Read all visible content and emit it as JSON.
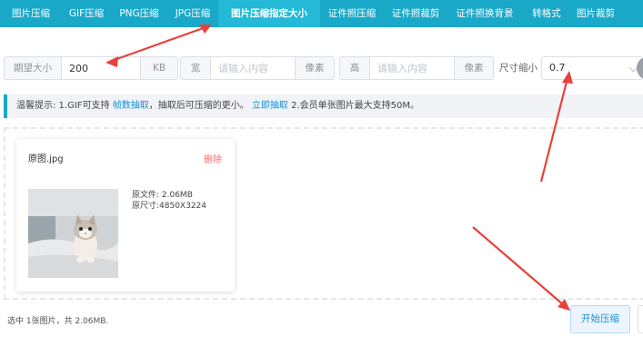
{
  "nav": {
    "tabs": [
      {
        "label": "图片压缩"
      },
      {
        "label": "GIF压缩"
      },
      {
        "label": "PNG压缩"
      },
      {
        "label": "JPG压缩"
      },
      {
        "label": "图片压缩指定大小",
        "active": true
      },
      {
        "label": "证件照压缩"
      },
      {
        "label": "证件照裁剪"
      },
      {
        "label": "证件照换背景"
      },
      {
        "label": "转格式"
      },
      {
        "label": "图片裁剪"
      }
    ]
  },
  "form": {
    "size_label": "期望大小",
    "size_value": "200",
    "size_unit": "KB",
    "width_label": "宽",
    "width_placeholder": "请输入内容",
    "width_unit": "像素",
    "height_label": "高",
    "height_placeholder": "请输入内容",
    "height_unit": "像素",
    "scale_label": "尺寸缩小",
    "scale_value": "0.7"
  },
  "tip": {
    "prefix": "温馨提示: 1.GIF可支持 ",
    "link1": "帧数抽取",
    "middle": "，抽取后可压缩的更小。",
    "link2": "立即抽取",
    "suffix": " 2.会员单张图片最大支持50M。"
  },
  "card": {
    "filename": "原图.jpg",
    "delete_label": "删除",
    "file_size": "原文件: 2.06MB",
    "dimensions": "原尺寸:4850X3224"
  },
  "footer": {
    "summary": "选中 1张图片，共 2.06MB.",
    "start_label": "开始压缩"
  },
  "colors": {
    "nav_bg": "#1aa8c9",
    "arrow": "#e8403a",
    "link": "#1a8fd0",
    "delete": "#f56c6c"
  }
}
